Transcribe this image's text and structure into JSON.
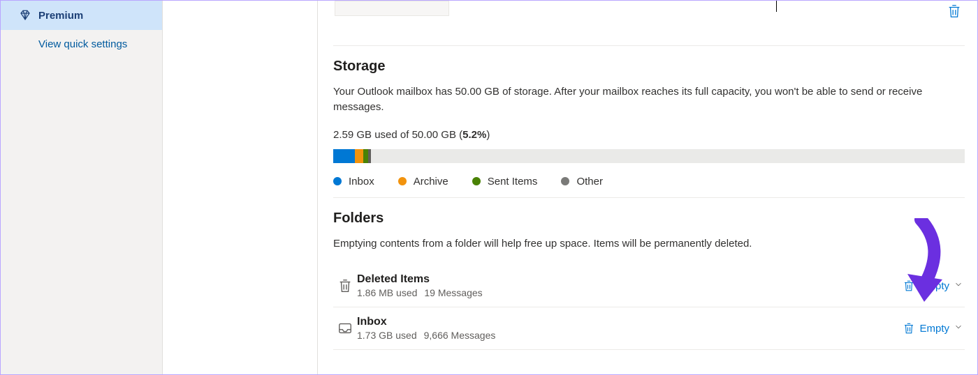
{
  "sidebar": {
    "premium_label": "Premium",
    "quick_settings_label": "View quick settings"
  },
  "storage": {
    "heading": "Storage",
    "description": "Your Outlook mailbox has 50.00 GB of storage. After your mailbox reaches its full capacity, you won't be able to send or receive messages.",
    "used_label": "2.59 GB used of 50.00 GB (",
    "percent_label": "5.2%",
    "close_paren": ")",
    "segments": [
      {
        "name": "Inbox",
        "color": "#0078d4",
        "width_pct": 3.46
      },
      {
        "name": "Archive",
        "color": "#f2930d",
        "width_pct": 1.33
      },
      {
        "name": "Sent Items",
        "color": "#498205",
        "width_pct": 0.77
      },
      {
        "name": "Other",
        "color": "#605e5c",
        "width_pct": 0.4
      }
    ],
    "legend": {
      "inbox": "Inbox",
      "archive": "Archive",
      "sent": "Sent Items",
      "other": "Other"
    }
  },
  "folders": {
    "heading": "Folders",
    "description": "Emptying contents from a folder will help free up space. Items will be permanently deleted.",
    "empty_label": "Empty",
    "items": [
      {
        "name": "Deleted Items",
        "used": "1.86 MB used",
        "messages": "19 Messages",
        "icon": "trash"
      },
      {
        "name": "Inbox",
        "used": "1.73 GB used",
        "messages": "9,666 Messages",
        "icon": "inbox"
      }
    ]
  }
}
